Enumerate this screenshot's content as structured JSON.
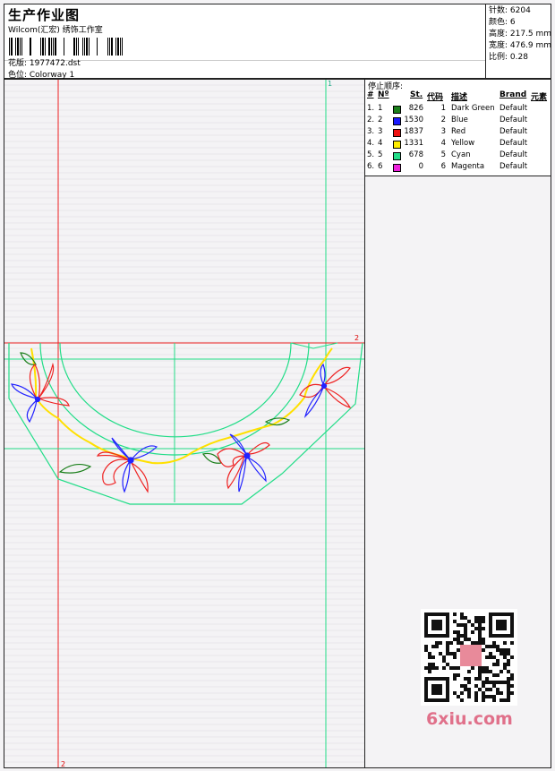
{
  "header": {
    "title": "生产作业图",
    "subtitle": "Wilcom(汇宏) 绣饰工作室",
    "design_label": "花版: 1977472.dst",
    "colorway_label": "色位: Colorway 1"
  },
  "stats": [
    {
      "label": "针数: 6204"
    },
    {
      "label": "颜色: 6"
    },
    {
      "label": "高度: 217.5 mm"
    },
    {
      "label": "宽度: 476.9 mm"
    },
    {
      "label": "比例: 0.28"
    }
  ],
  "sequence": {
    "title": "停止顺序:",
    "headers": {
      "num": "#",
      "n": "Nº",
      "st": "St.",
      "code": "代码",
      "desc": "描述",
      "brand": "Brand",
      "elem": "元素"
    },
    "rows": [
      {
        "num": "1.",
        "n": "1",
        "st": "826",
        "code": "1",
        "desc": "Dark Green",
        "brand": "Default",
        "color": "#1a7f1a"
      },
      {
        "num": "2.",
        "n": "2",
        "st": "1530",
        "code": "2",
        "desc": "Blue",
        "brand": "Default",
        "color": "#1a1aff"
      },
      {
        "num": "3.",
        "n": "3",
        "st": "1837",
        "code": "3",
        "desc": "Red",
        "brand": "Default",
        "color": "#ee1111"
      },
      {
        "num": "4.",
        "n": "4",
        "st": "1331",
        "code": "4",
        "desc": "Yellow",
        "brand": "Default",
        "color": "#ffee00"
      },
      {
        "num": "5.",
        "n": "5",
        "st": "678",
        "code": "5",
        "desc": "Cyan",
        "brand": "Default",
        "color": "#22dd88"
      },
      {
        "num": "6.",
        "n": "6",
        "st": "0",
        "code": "6",
        "desc": "Magenta",
        "brand": "Default",
        "color": "#ee22dd"
      }
    ]
  },
  "canvas": {
    "marker_top": "1",
    "marker_right": "2",
    "marker_bottom": "2"
  },
  "watermark": {
    "site": "6xiu.com"
  }
}
